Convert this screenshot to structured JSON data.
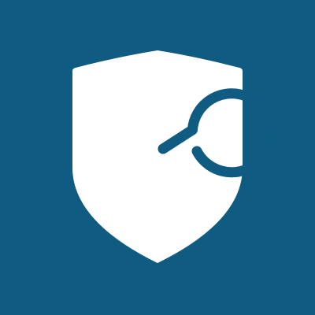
{
  "app_icon": {
    "background_color": "#0f5b82",
    "shield_color": "#ffffff",
    "emblem_color": "#0f5b82",
    "icon_name": "shield-e-logo-icon"
  }
}
